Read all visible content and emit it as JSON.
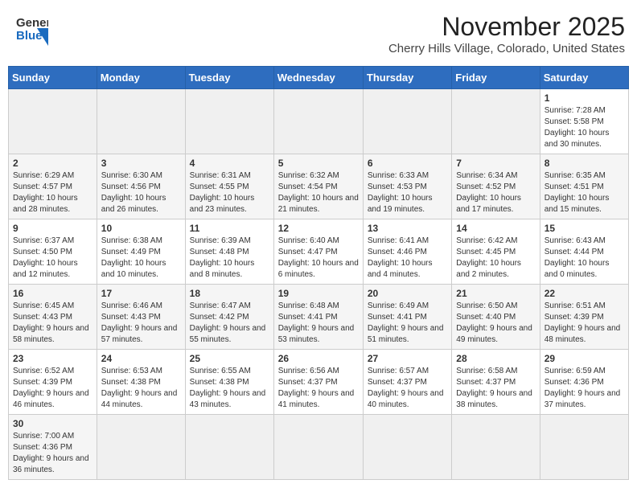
{
  "header": {
    "logo_line1": "General",
    "logo_line2": "Blue",
    "title": "November 2025",
    "subtitle": "Cherry Hills Village, Colorado, United States"
  },
  "weekdays": [
    "Sunday",
    "Monday",
    "Tuesday",
    "Wednesday",
    "Thursday",
    "Friday",
    "Saturday"
  ],
  "weeks": [
    [
      {
        "day": "",
        "info": ""
      },
      {
        "day": "",
        "info": ""
      },
      {
        "day": "",
        "info": ""
      },
      {
        "day": "",
        "info": ""
      },
      {
        "day": "",
        "info": ""
      },
      {
        "day": "",
        "info": ""
      },
      {
        "day": "1",
        "info": "Sunrise: 7:28 AM\nSunset: 5:58 PM\nDaylight: 10 hours and 30 minutes."
      }
    ],
    [
      {
        "day": "2",
        "info": "Sunrise: 6:29 AM\nSunset: 4:57 PM\nDaylight: 10 hours and 28 minutes."
      },
      {
        "day": "3",
        "info": "Sunrise: 6:30 AM\nSunset: 4:56 PM\nDaylight: 10 hours and 26 minutes."
      },
      {
        "day": "4",
        "info": "Sunrise: 6:31 AM\nSunset: 4:55 PM\nDaylight: 10 hours and 23 minutes."
      },
      {
        "day": "5",
        "info": "Sunrise: 6:32 AM\nSunset: 4:54 PM\nDaylight: 10 hours and 21 minutes."
      },
      {
        "day": "6",
        "info": "Sunrise: 6:33 AM\nSunset: 4:53 PM\nDaylight: 10 hours and 19 minutes."
      },
      {
        "day": "7",
        "info": "Sunrise: 6:34 AM\nSunset: 4:52 PM\nDaylight: 10 hours and 17 minutes."
      },
      {
        "day": "8",
        "info": "Sunrise: 6:35 AM\nSunset: 4:51 PM\nDaylight: 10 hours and 15 minutes."
      }
    ],
    [
      {
        "day": "9",
        "info": "Sunrise: 6:37 AM\nSunset: 4:50 PM\nDaylight: 10 hours and 12 minutes."
      },
      {
        "day": "10",
        "info": "Sunrise: 6:38 AM\nSunset: 4:49 PM\nDaylight: 10 hours and 10 minutes."
      },
      {
        "day": "11",
        "info": "Sunrise: 6:39 AM\nSunset: 4:48 PM\nDaylight: 10 hours and 8 minutes."
      },
      {
        "day": "12",
        "info": "Sunrise: 6:40 AM\nSunset: 4:47 PM\nDaylight: 10 hours and 6 minutes."
      },
      {
        "day": "13",
        "info": "Sunrise: 6:41 AM\nSunset: 4:46 PM\nDaylight: 10 hours and 4 minutes."
      },
      {
        "day": "14",
        "info": "Sunrise: 6:42 AM\nSunset: 4:45 PM\nDaylight: 10 hours and 2 minutes."
      },
      {
        "day": "15",
        "info": "Sunrise: 6:43 AM\nSunset: 4:44 PM\nDaylight: 10 hours and 0 minutes."
      }
    ],
    [
      {
        "day": "16",
        "info": "Sunrise: 6:45 AM\nSunset: 4:43 PM\nDaylight: 9 hours and 58 minutes."
      },
      {
        "day": "17",
        "info": "Sunrise: 6:46 AM\nSunset: 4:43 PM\nDaylight: 9 hours and 57 minutes."
      },
      {
        "day": "18",
        "info": "Sunrise: 6:47 AM\nSunset: 4:42 PM\nDaylight: 9 hours and 55 minutes."
      },
      {
        "day": "19",
        "info": "Sunrise: 6:48 AM\nSunset: 4:41 PM\nDaylight: 9 hours and 53 minutes."
      },
      {
        "day": "20",
        "info": "Sunrise: 6:49 AM\nSunset: 4:41 PM\nDaylight: 9 hours and 51 minutes."
      },
      {
        "day": "21",
        "info": "Sunrise: 6:50 AM\nSunset: 4:40 PM\nDaylight: 9 hours and 49 minutes."
      },
      {
        "day": "22",
        "info": "Sunrise: 6:51 AM\nSunset: 4:39 PM\nDaylight: 9 hours and 48 minutes."
      }
    ],
    [
      {
        "day": "23",
        "info": "Sunrise: 6:52 AM\nSunset: 4:39 PM\nDaylight: 9 hours and 46 minutes."
      },
      {
        "day": "24",
        "info": "Sunrise: 6:53 AM\nSunset: 4:38 PM\nDaylight: 9 hours and 44 minutes."
      },
      {
        "day": "25",
        "info": "Sunrise: 6:55 AM\nSunset: 4:38 PM\nDaylight: 9 hours and 43 minutes."
      },
      {
        "day": "26",
        "info": "Sunrise: 6:56 AM\nSunset: 4:37 PM\nDaylight: 9 hours and 41 minutes."
      },
      {
        "day": "27",
        "info": "Sunrise: 6:57 AM\nSunset: 4:37 PM\nDaylight: 9 hours and 40 minutes."
      },
      {
        "day": "28",
        "info": "Sunrise: 6:58 AM\nSunset: 4:37 PM\nDaylight: 9 hours and 38 minutes."
      },
      {
        "day": "29",
        "info": "Sunrise: 6:59 AM\nSunset: 4:36 PM\nDaylight: 9 hours and 37 minutes."
      }
    ],
    [
      {
        "day": "30",
        "info": "Sunrise: 7:00 AM\nSunset: 4:36 PM\nDaylight: 9 hours and 36 minutes."
      },
      {
        "day": "",
        "info": ""
      },
      {
        "day": "",
        "info": ""
      },
      {
        "day": "",
        "info": ""
      },
      {
        "day": "",
        "info": ""
      },
      {
        "day": "",
        "info": ""
      },
      {
        "day": "",
        "info": ""
      }
    ]
  ]
}
